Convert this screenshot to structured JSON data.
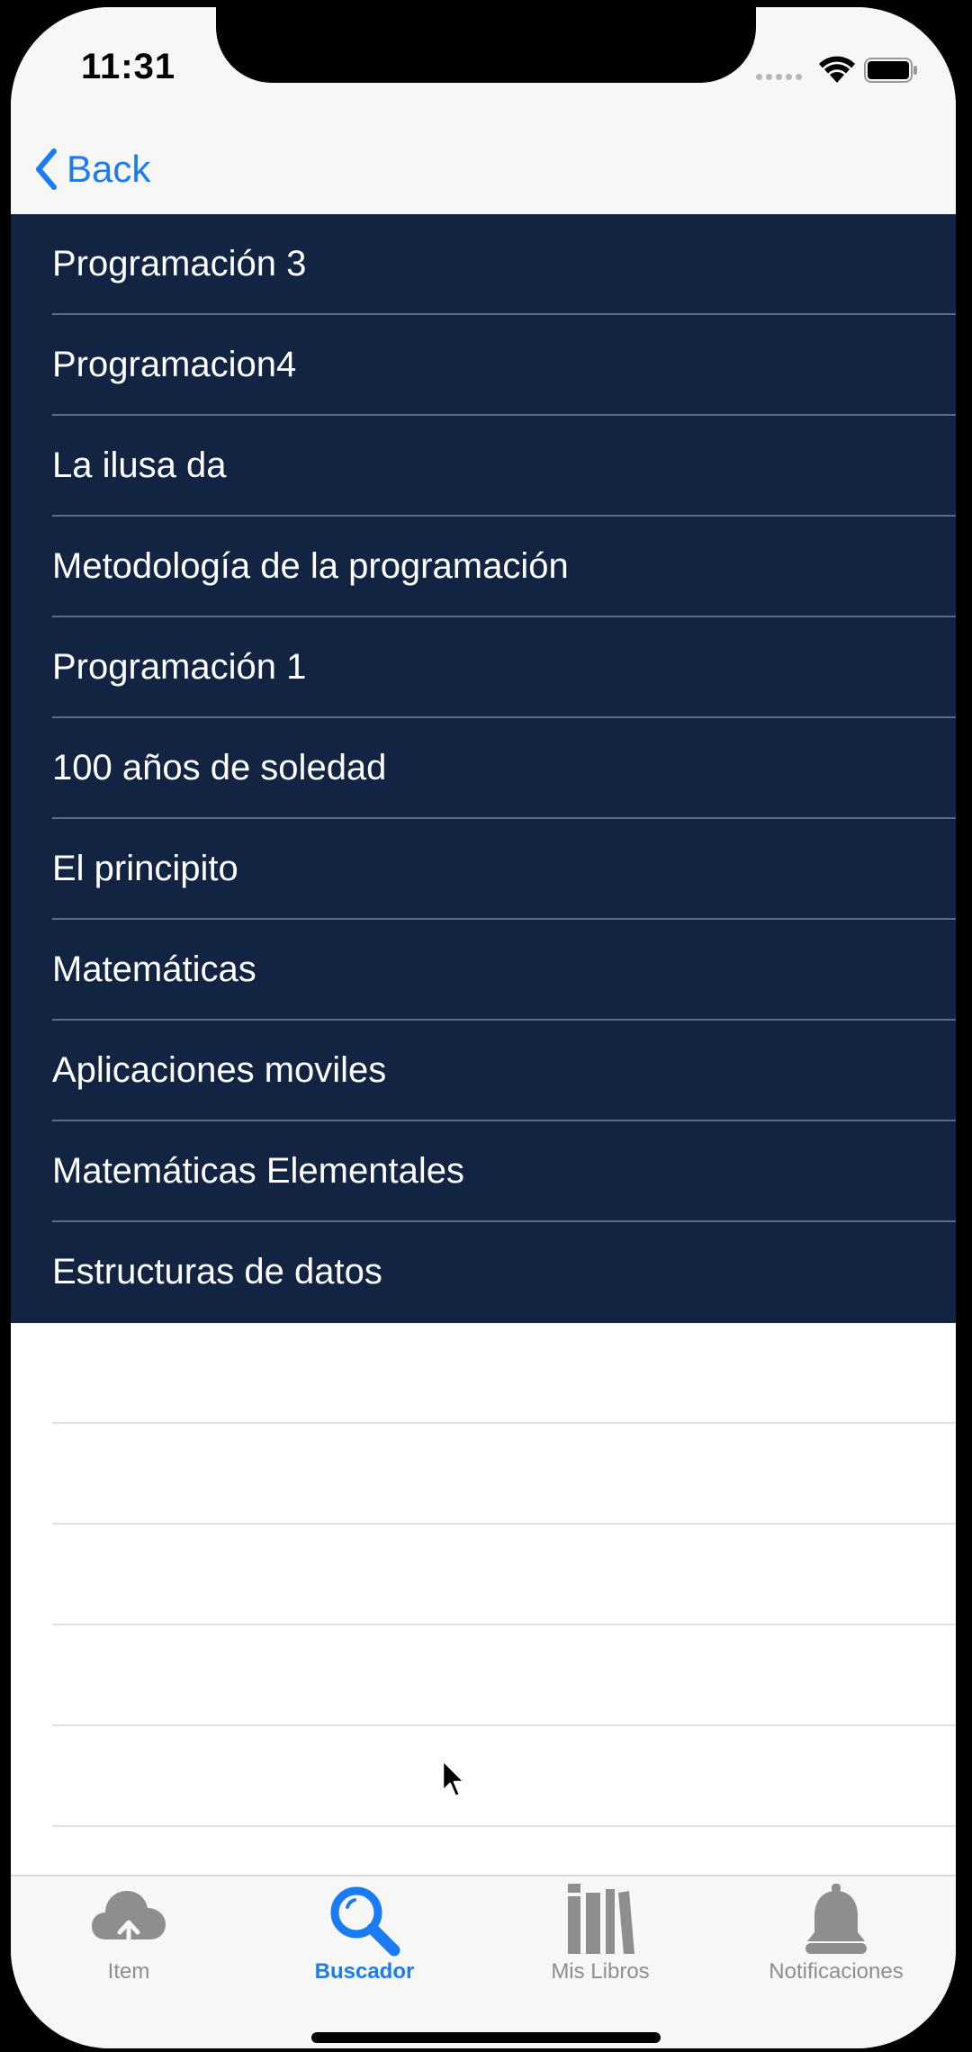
{
  "status_bar": {
    "time": "11:31"
  },
  "nav": {
    "back_label": "Back"
  },
  "books": [
    "Programación 3",
    "Programacion4",
    "La ilusa da",
    "Metodología de la programación",
    "Programación 1",
    "100 años de soledad",
    "El principito",
    "Matemáticas",
    "Aplicaciones moviles",
    "Matemáticas Elementales",
    "Estructuras de datos"
  ],
  "tabs": [
    {
      "label": "Item",
      "icon": "cloud-upload-icon",
      "active": false
    },
    {
      "label": "Buscador",
      "icon": "search-icon",
      "active": true
    },
    {
      "label": "Mis Libros",
      "icon": "books-icon",
      "active": false
    },
    {
      "label": "Notificaciones",
      "icon": "bell-icon",
      "active": false
    }
  ],
  "colors": {
    "accent": "#1a7cf5",
    "list_background": "#122442",
    "inactive_tab": "#8e8e8e"
  }
}
